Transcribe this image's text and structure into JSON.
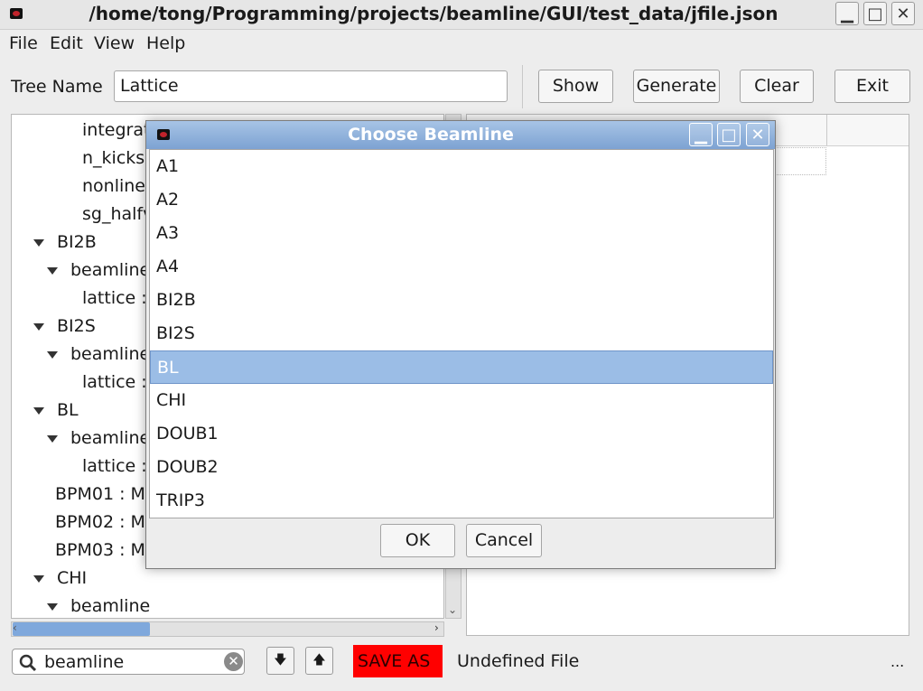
{
  "window": {
    "title": "/home/tong/Programming/projects/beamline/GUI/test_data/jfile.json"
  },
  "menu": [
    "File",
    "Edit",
    "View",
    "Help"
  ],
  "toolbar": {
    "tree_name_label": "Tree Name",
    "tree_name_value": "Lattice",
    "show": "Show",
    "generate": "Generate",
    "clear": "Clear",
    "exit": "Exit"
  },
  "tree": {
    "rows": [
      {
        "text": "integrat",
        "expandable": false
      },
      {
        "text": "n_kicks",
        "expandable": false
      },
      {
        "text": "nonline",
        "expandable": false
      },
      {
        "text": "sg_halfv",
        "expandable": false
      },
      {
        "text": "BI2B",
        "expandable": true
      },
      {
        "text": "beamline",
        "expandable": true
      },
      {
        "text": "lattice :",
        "expandable": false
      },
      {
        "text": "BI2S",
        "expandable": true
      },
      {
        "text": "beamline",
        "expandable": true
      },
      {
        "text": "lattice :",
        "expandable": false
      },
      {
        "text": "BL",
        "expandable": true
      },
      {
        "text": "beamline",
        "expandable": true
      },
      {
        "text": "lattice :",
        "expandable": false
      },
      {
        "text": "BPM01 : M",
        "expandable": false
      },
      {
        "text": "BPM02 : M",
        "expandable": false
      },
      {
        "text": "BPM03 : M",
        "expandable": false
      },
      {
        "text": "CHI",
        "expandable": true
      },
      {
        "text": "beamline",
        "expandable": true
      }
    ]
  },
  "bottom": {
    "search_value": "beamline",
    "save_as": "SAVE AS",
    "status": "Undefined File",
    "more": "..."
  },
  "dialog": {
    "title": "Choose Beamline",
    "items": [
      "A1",
      "A2",
      "A3",
      "A4",
      "BI2B",
      "BI2S",
      "BL",
      "CHI",
      "DOUB1",
      "DOUB2",
      "TRIP3"
    ],
    "selected": "BL",
    "ok": "OK",
    "cancel": "Cancel"
  },
  "colors": {
    "selection": "#9bbde6",
    "save_as_bg": "#ff0000",
    "dialog_title": "#8fb1dc"
  }
}
